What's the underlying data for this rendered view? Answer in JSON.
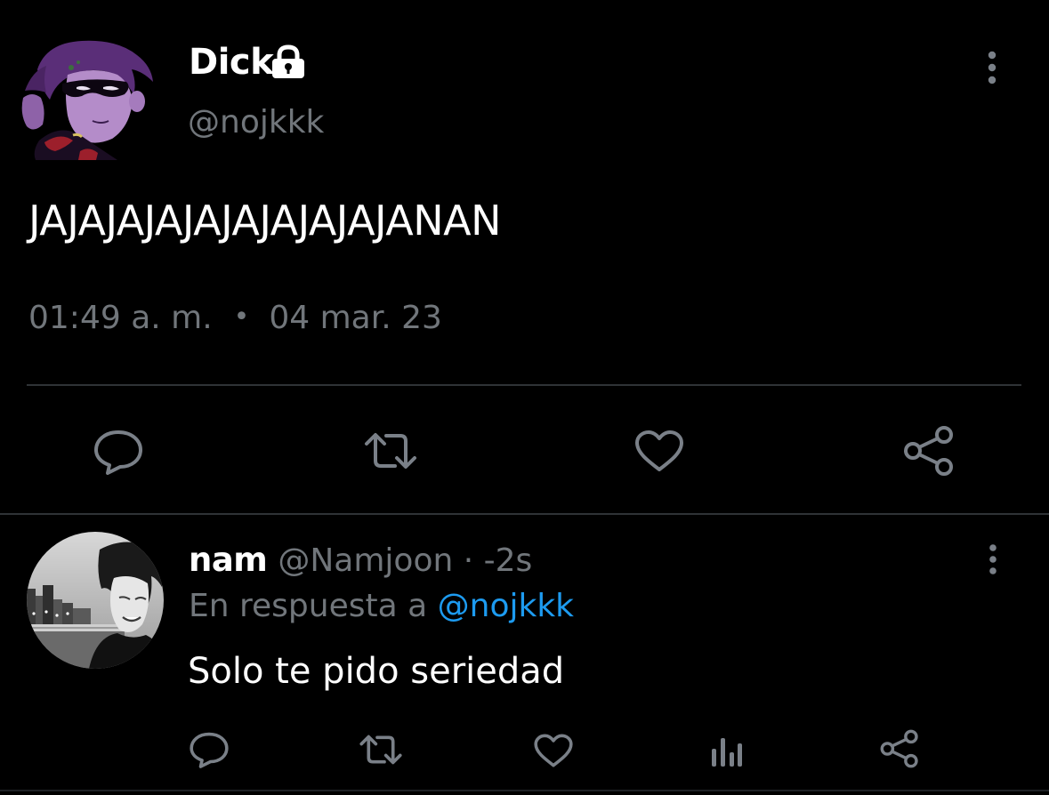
{
  "tweet": {
    "author": {
      "display_name": "Dick",
      "handle": "@nojkkk",
      "avatar": "robin-cartoon-avatar",
      "protected_icon": "lock-icon"
    },
    "text": "JAJAJAJAJAJAJAJAJAJANAN",
    "time": "01:49 a. m.",
    "separator": "•",
    "date": "04 mar. 23",
    "more_icon": "more-vertical-icon",
    "actions": [
      "reply-icon",
      "retweet-icon",
      "like-icon",
      "share-icon"
    ]
  },
  "reply": {
    "author": {
      "display_name": "nam",
      "handle": "@Namjoon",
      "avatar": "grayscale-photo-avatar"
    },
    "timestamp": "· -2s",
    "reply_prefix": "En respuesta a",
    "reply_mention": "@nojkkk",
    "text": "Solo te pido seriedad",
    "more_icon": "more-vertical-icon",
    "actions": [
      "reply-icon",
      "retweet-icon",
      "like-icon",
      "analytics-icon",
      "share-icon"
    ]
  },
  "colors": {
    "background": "#000000",
    "primary_text": "#ffffff",
    "secondary_text": "#71767b",
    "link": "#1d9bf0",
    "divider": "#2f3336",
    "icon": "#7a8088"
  }
}
